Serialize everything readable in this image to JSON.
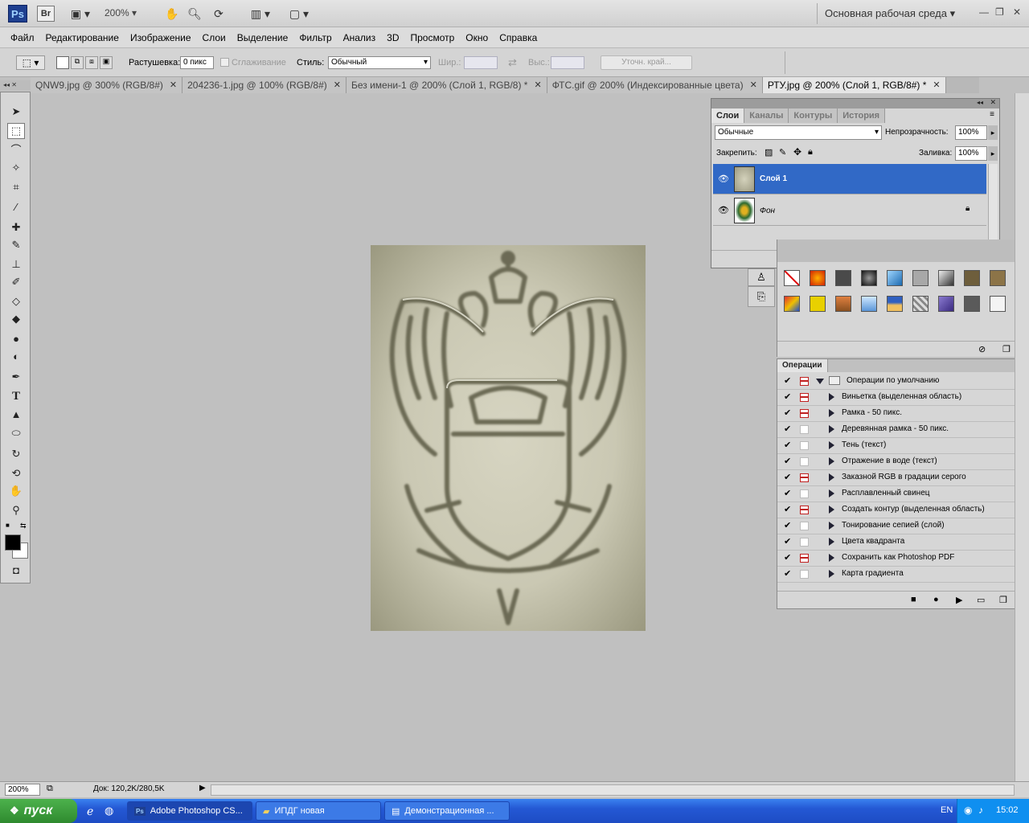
{
  "app": {
    "logo_text": "Ps",
    "bridge_text": "Br",
    "zoom_value": "200%",
    "workspace": "Основная рабочая среда"
  },
  "menu": [
    "Файл",
    "Редактирование",
    "Изображение",
    "Слои",
    "Выделение",
    "Фильтр",
    "Анализ",
    "3D",
    "Просмотр",
    "Окно",
    "Справка"
  ],
  "options": {
    "feather_label": "Растушевка:",
    "feather_value": "0 пикс",
    "antialias_label": "Сглаживание",
    "style_label": "Стиль:",
    "style_value": "Обычный",
    "width_label": "Шир.:",
    "height_label": "Выс.:",
    "refine_edge": "Уточн. край..."
  },
  "tabs": [
    {
      "label": "QNW9.jpg @ 300% (RGB/8#)",
      "close": "✕"
    },
    {
      "label": "204236-1.jpg @ 100% (RGB/8#)",
      "close": "✕"
    },
    {
      "label": "Без имени-1 @ 200% (Слой 1, RGB/8) *",
      "close": "✕"
    },
    {
      "label": "ФТС.gif @ 200% (Индексированные цвета)",
      "close": "✕"
    },
    {
      "label": "РТУ.jpg @ 200% (Слой 1, RGB/8#) *",
      "close": "✕"
    }
  ],
  "layers_panel": {
    "tabs": [
      "Слои",
      "Каналы",
      "Контуры",
      "История"
    ],
    "blend_mode": "Обычные",
    "opacity_label": "Непрозрачность:",
    "opacity_value": "100%",
    "lock_label": "Закрепить:",
    "fill_label": "Заливка:",
    "fill_value": "100%",
    "layers": [
      {
        "name": "Слой 1",
        "selected": true
      },
      {
        "name": "Фон",
        "selected": false
      }
    ]
  },
  "actions_panel": {
    "title": "Операции",
    "set_name": "Операции по умолчанию",
    "items": [
      {
        "label": "Виньетка (выделенная область)",
        "dialog": true
      },
      {
        "label": "Рамка - 50 пикс.",
        "dialog": true
      },
      {
        "label": "Деревянная рамка - 50 пикс.",
        "dialog": false
      },
      {
        "label": "Тень (текст)",
        "dialog": false
      },
      {
        "label": "Отражение в воде (текст)",
        "dialog": false
      },
      {
        "label": "Заказной RGB в градации серого",
        "dialog": true
      },
      {
        "label": "Расплавленный свинец",
        "dialog": false
      },
      {
        "label": "Создать контур (выделенная область)",
        "dialog": true
      },
      {
        "label": "Тонирование сепией (слой)",
        "dialog": false
      },
      {
        "label": "Цвета квадранта",
        "dialog": false
      },
      {
        "label": "Сохранить как Photoshop PDF",
        "dialog": true
      },
      {
        "label": "Карта градиента",
        "dialog": false
      }
    ]
  },
  "status": {
    "zoom": "200%",
    "doc_info": "Док: 120,2K/280,5K"
  },
  "taskbar": {
    "start": "пуск",
    "buttons": [
      "Adobe Photoshop CS...",
      "ИПДГ новая",
      "Демонстрационная ..."
    ],
    "lang": "EN",
    "time": "15:02"
  },
  "colors": {
    "selection": "#3169c6",
    "taskbar": "#2458d4",
    "start": "#3a9a3a"
  }
}
